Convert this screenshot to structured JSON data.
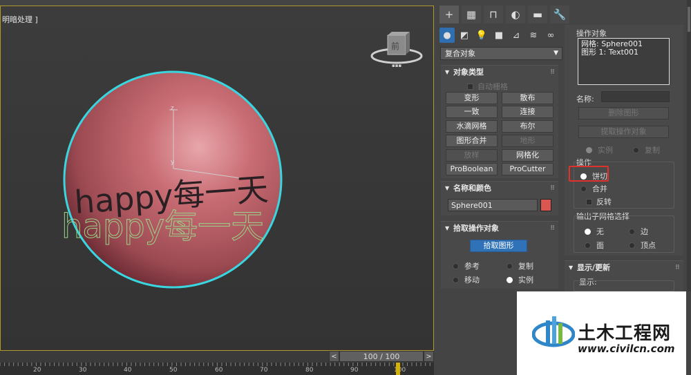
{
  "viewport": {
    "label": "明暗处理 ]",
    "viewcube_face": "前",
    "axis_z": "z",
    "axis_y": "y",
    "text_solid": "happy每一天",
    "text_outline": "happy每一天",
    "colors": {
      "sphere": "#c96d74",
      "sphere_outline": "#3ad6e0",
      "text_outline": "#9ad48a",
      "border": "#b09a2c"
    }
  },
  "timeline": {
    "slider_label": "100 / 100",
    "prev": "<",
    "next": ">",
    "ticks": [
      "20",
      "30",
      "40",
      "50",
      "60",
      "70",
      "80",
      "90",
      "100"
    ]
  },
  "panel": {
    "tabs": [
      "+",
      "▦",
      "⊓",
      "◐",
      "▬",
      "🔧"
    ],
    "sub_tabs": [
      "●",
      "◩",
      "💡",
      "■",
      "⊿",
      "≋",
      "∞"
    ],
    "category": "复合对象",
    "object_type": {
      "title": "对象类型",
      "auto_grid": "自动栅格",
      "buttons": [
        {
          "label": "变形",
          "disabled": false
        },
        {
          "label": "散布",
          "disabled": false
        },
        {
          "label": "一致",
          "disabled": false
        },
        {
          "label": "连接",
          "disabled": false
        },
        {
          "label": "水滴网格",
          "disabled": false
        },
        {
          "label": "布尔",
          "disabled": false
        },
        {
          "label": "图形合并",
          "disabled": false
        },
        {
          "label": "地形",
          "disabled": true
        },
        {
          "label": "放样",
          "disabled": true
        },
        {
          "label": "网格化",
          "disabled": false
        },
        {
          "label": "ProBoolean",
          "disabled": false
        },
        {
          "label": "ProCutter",
          "disabled": false
        }
      ]
    },
    "name_color": {
      "title": "名称和颜色",
      "name": "Sphere001",
      "swatch": "#d9574f"
    },
    "pick_operand": {
      "title": "拾取操作对象",
      "pick_button": "拾取图形",
      "options": [
        {
          "label": "参考",
          "on": false
        },
        {
          "label": "复制",
          "on": false
        },
        {
          "label": "移动",
          "on": false
        },
        {
          "label": "实例",
          "on": true
        }
      ]
    },
    "operands": {
      "label": "操作对象",
      "items": [
        "网格: Sphere001",
        "图形 1: Text001"
      ],
      "name_label": "名称:",
      "delete_shape": "删除图形",
      "extract_operand": "提取操作对象",
      "instance": "实例",
      "copy": "复制"
    },
    "operation": {
      "label": "操作",
      "cookie_cutter": "饼切",
      "merge": "合并",
      "invert": "反转"
    },
    "output_selection": {
      "label": "输出子网格选择",
      "none": "无",
      "edge": "边",
      "face": "面",
      "vertex": "顶点"
    },
    "display_update": {
      "title": "显示/更新",
      "display_label": "显示:"
    }
  },
  "watermark": {
    "title": "土木工程网",
    "url": "www.civilcn.com"
  }
}
